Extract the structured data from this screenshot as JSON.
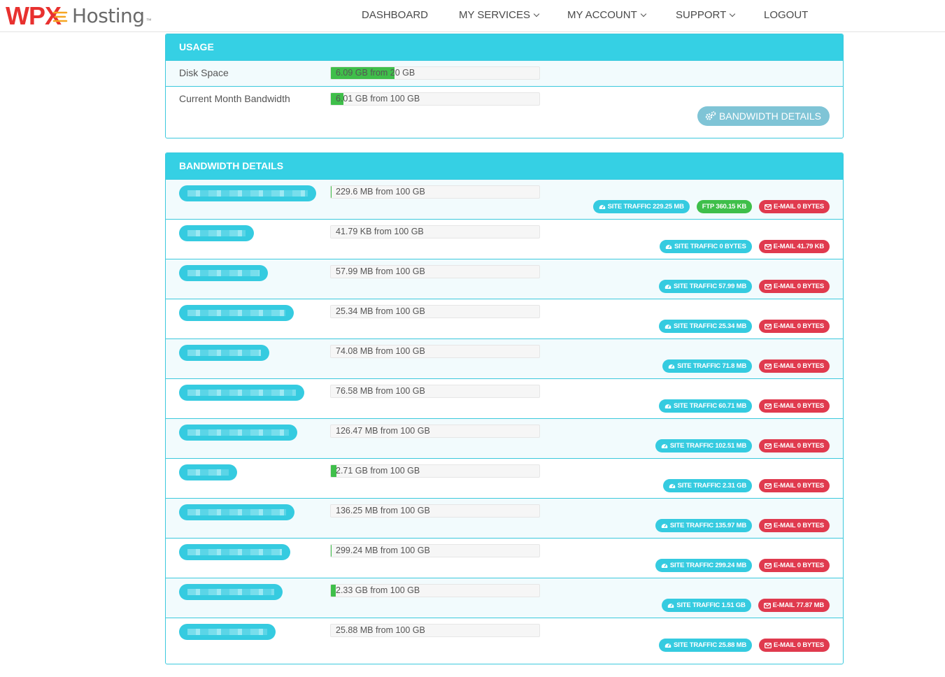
{
  "brand": {
    "name": "WPX",
    "product": "Hosting",
    "tm": "™"
  },
  "nav": {
    "dashboard": "DASHBOARD",
    "services": "MY SERVICES",
    "account": "MY ACCOUNT",
    "support": "SUPPORT",
    "logout": "LOGOUT"
  },
  "usage": {
    "title": "USAGE",
    "disk": {
      "label": "Disk Space",
      "text": "6.09 GB from 20 GB",
      "fraction": 0.3045
    },
    "bandwidth": {
      "label": "Current Month Bandwidth",
      "text": "6.01 GB from 100 GB",
      "fraction": 0.0601
    },
    "button": "BANDWIDTH DETAILS"
  },
  "details": {
    "title": "BANDWIDTH DETAILS",
    "rows": [
      {
        "text": "229.6 MB from 100 GB",
        "fraction": 0.0022,
        "site": "SITE TRAFFIC 229.25 MB",
        "ftp": "FTP 360.15 KB",
        "mail": "E-MAIL 0 BYTES"
      },
      {
        "text": "41.79 KB from 100 GB",
        "fraction": 0,
        "site": "SITE TRAFFIC 0 BYTES",
        "mail": "E-MAIL 41.79 KB"
      },
      {
        "text": "57.99 MB from 100 GB",
        "fraction": 0.0006,
        "site": "SITE TRAFFIC 57.99 MB",
        "mail": "E-MAIL 0 BYTES"
      },
      {
        "text": "25.34 MB from 100 GB",
        "fraction": 0.0003,
        "site": "SITE TRAFFIC 25.34 MB",
        "mail": "E-MAIL 0 BYTES"
      },
      {
        "text": "74.08 MB from 100 GB",
        "fraction": 0.0007,
        "site": "SITE TRAFFIC 71.8 MB",
        "mail": "E-MAIL 0 BYTES"
      },
      {
        "text": "76.58 MB from 100 GB",
        "fraction": 0.0007,
        "site": "SITE TRAFFIC 60.71 MB",
        "mail": "E-MAIL 0 BYTES"
      },
      {
        "text": "126.47 MB from 100 GB",
        "fraction": 0.0012,
        "site": "SITE TRAFFIC 102.51 MB",
        "mail": "E-MAIL 0 BYTES"
      },
      {
        "text": "2.71 GB from 100 GB",
        "fraction": 0.0271,
        "site": "SITE TRAFFIC 2.31 GB",
        "mail": "E-MAIL 0 BYTES"
      },
      {
        "text": "136.25 MB from 100 GB",
        "fraction": 0.0013,
        "site": "SITE TRAFFIC 135.97 MB",
        "mail": "E-MAIL 0 BYTES"
      },
      {
        "text": "299.24 MB from 100 GB",
        "fraction": 0.0029,
        "site": "SITE TRAFFIC 299.24 MB",
        "mail": "E-MAIL 0 BYTES"
      },
      {
        "text": "2.33 GB from 100 GB",
        "fraction": 0.0233,
        "site": "SITE TRAFFIC 1.51 GB",
        "mail": "E-MAIL 77.87 MB"
      },
      {
        "text": "25.88 MB from 100 GB",
        "fraction": 0.0003,
        "site": "SITE TRAFFIC 25.88 MB",
        "mail": "E-MAIL 0 BYTES"
      }
    ]
  },
  "colors": {
    "accent": "#35d0e4",
    "progress": "#3fbf4a",
    "email_badge": "#e03a4e",
    "button": "#7fc4d6"
  },
  "icons": {
    "site_traffic": "dashboard-gauge-icon",
    "email": "envelope-icon",
    "bandwidth_button": "gears-icon",
    "menu": "chevron-down-icon"
  }
}
